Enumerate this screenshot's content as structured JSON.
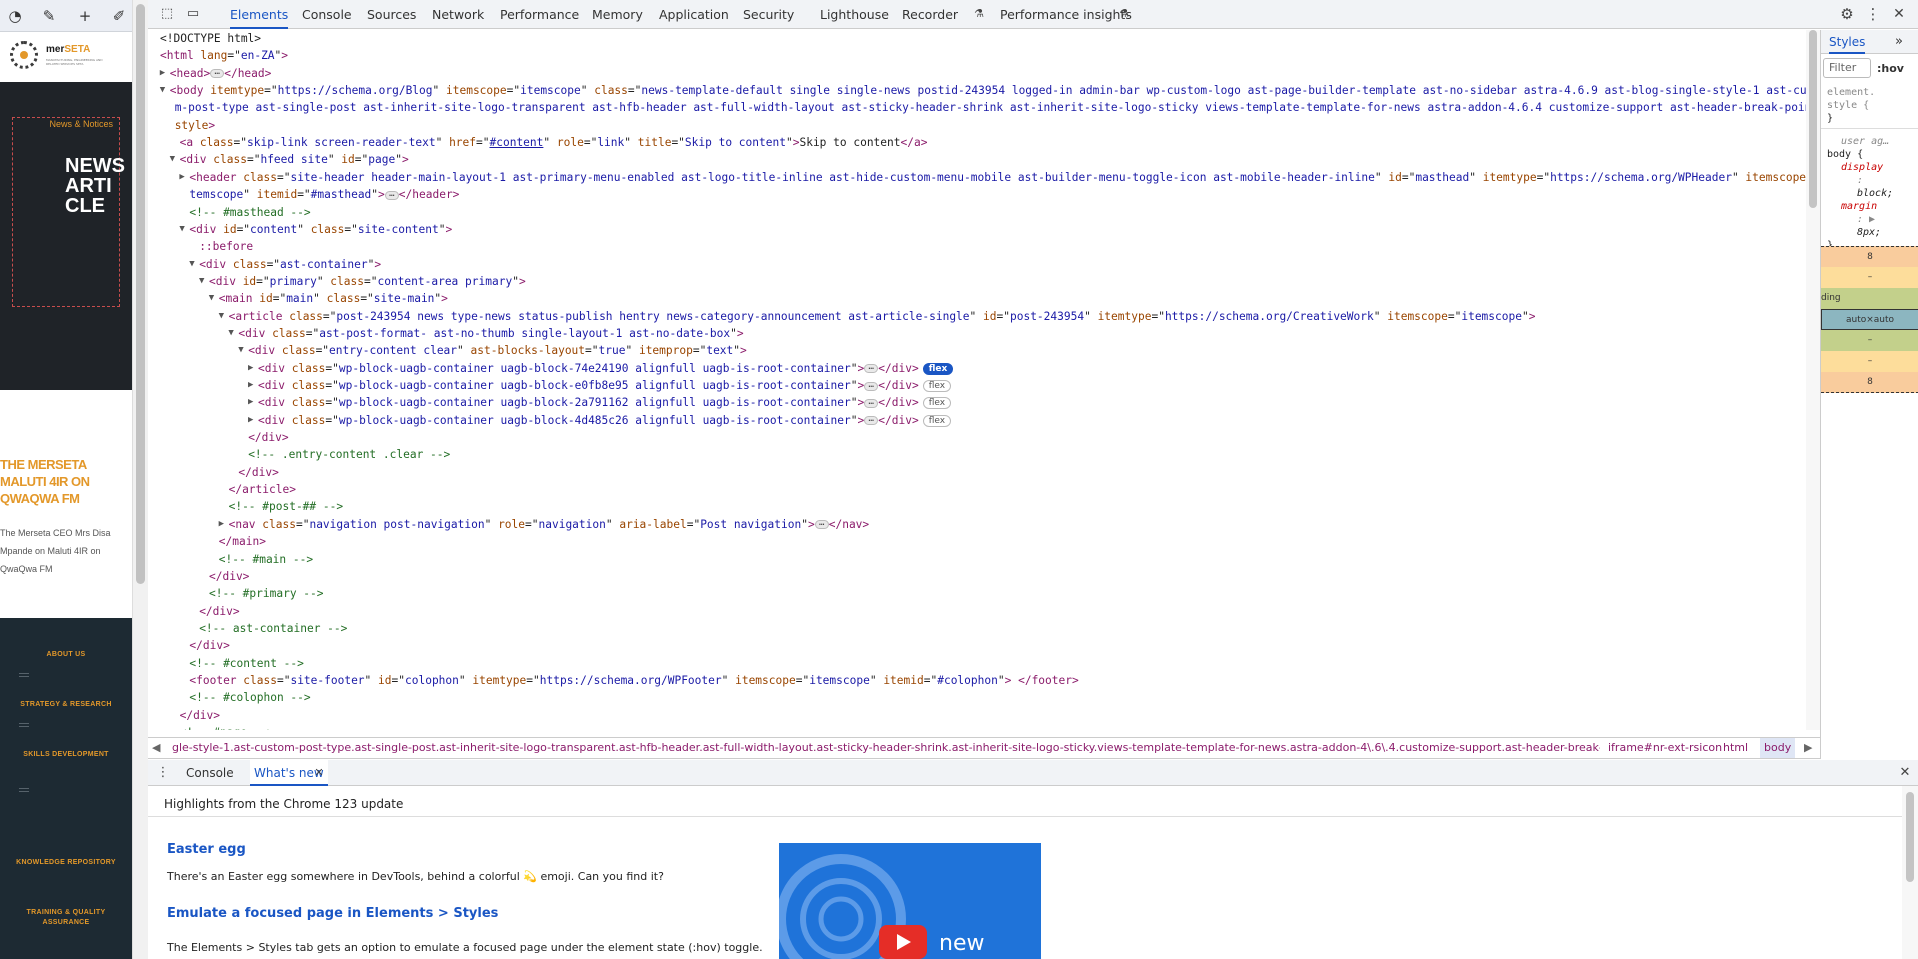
{
  "site": {
    "logo_brand": "mer",
    "logo_brand_accent": "SETA",
    "logo_tagline": "MANUFACTURING, ENGINEERING AND RELATED SERVICES SETA",
    "hero_tag": "News & Notices",
    "hero_title": "NEWS ARTICLE",
    "article_title": "THE MERSETA MALUTI 4IR ON QWAQWA FM",
    "article_desc": "The Merseta CEO Mrs Disa Mpande on Maluti 4IR on QwaQwa FM",
    "menu": [
      "ABOUT US",
      "STRATEGY & RESEARCH",
      "SKILLS DEVELOPMENT",
      "KNOWLEDGE REPOSITORY",
      "TRAINING & QUALITY ASSURANCE"
    ]
  },
  "devtools": {
    "tabs": [
      "Elements",
      "Console",
      "Sources",
      "Network",
      "Performance",
      "Memory",
      "Application",
      "Security",
      "Lighthouse",
      "Recorder",
      "Performance insights"
    ],
    "active_tab": "Elements",
    "breadcrumbs": [
      "gle-style-1.ast-custom-post-type.ast-single-post.ast-inherit-site-logo-transparent.ast-hfb-header.ast-full-width-layout.ast-sticky-header-shrink.ast-inherit-site-logo-sticky.views-template-template-for-news.astra-addon-4\\.6\\.4.customize-support.ast-header-break-point",
      "iframe#nr-ext-rsicon",
      "html",
      "body"
    ],
    "styles": {
      "tab": "Styles",
      "filter_placeholder": "Filter",
      "hov": ":hov",
      "rule1_sel": "element.",
      "rule1_sel2": "style {",
      "rule1_end": "}",
      "ua_label": "user ag…",
      "rule2_sel": "body {",
      "prop1": "display",
      "prop1_val": "block;",
      "prop2": "margin",
      "prop2_val": "8px;",
      "rule2_end": "}",
      "box_margin": "8",
      "box_dash1": "–",
      "box_padding": "ding",
      "box_dash2": "–",
      "box_content": "auto×auto",
      "box_dash3": "–",
      "box_dash4": "–",
      "box_margin_bottom": "8"
    },
    "drawer": {
      "tabs": [
        "Console",
        "What's new"
      ],
      "heading": "Highlights from the Chrome 123 update",
      "item1_title": "Easter egg",
      "item1_text": "There's an Easter egg somewhere in DevTools, behind a colorful 💫 emoji. Can you find it?",
      "item2_title": "Emulate a focused page in Elements > Styles",
      "item2_text": "The Elements > Styles tab gets an option to emulate a focused page under the element state (:hov) toggle.",
      "video_word": "new"
    },
    "colors": {
      "accent": "#1a56c4",
      "brand_orange": "#e3982a",
      "tag": "#8b1c6b",
      "attr_name": "#994500",
      "attr_value": "#1a1aa6",
      "comment": "#236e25"
    }
  },
  "dom": [
    {
      "i": 0,
      "p": [
        [
          "pl",
          "<!DOCTYPE html>"
        ]
      ]
    },
    {
      "i": 0,
      "p": [
        [
          "tag",
          "<html"
        ],
        [
          "an",
          " lang"
        ],
        [
          "pl",
          "=\""
        ],
        [
          "av",
          "en-ZA"
        ],
        [
          "pl",
          "\""
        ],
        [
          "tag",
          ">"
        ]
      ]
    },
    {
      "i": 1,
      "a": "▶",
      "p": [
        [
          "tag",
          "<head>"
        ],
        [
          "ell"
        ],
        [
          "tag",
          "</head>"
        ]
      ]
    },
    {
      "i": 1,
      "a": "▼",
      "p": [
        [
          "tag",
          "<body"
        ],
        [
          "an",
          " itemtype"
        ],
        [
          "pl",
          "=\""
        ],
        [
          "av",
          "https://schema.org/Blog"
        ],
        [
          "pl",
          "\""
        ],
        [
          "an",
          " itemscope"
        ],
        [
          "pl",
          "=\""
        ],
        [
          "av",
          "itemscope"
        ],
        [
          "pl",
          "\""
        ],
        [
          "an",
          " class"
        ],
        [
          "pl",
          "=\""
        ],
        [
          "av",
          "news-template-default single single-news postid-243954 logged-in admin-bar wp-custom-logo ast-page-builder-template ast-no-sidebar astra-4.6.9 ast-blog-single-style-1 ast-custo"
        ]
      ]
    },
    {
      "i": 1.5,
      "p": [
        [
          "av",
          "m-post-type ast-single-post ast-inherit-site-logo-transparent ast-hfb-header ast-full-width-layout ast-sticky-header-shrink ast-inherit-site-logo-sticky views-template-template-for-news astra-addon-4.6.4 customize-support ast-header-break-point"
        ],
        [
          "pl",
          "\""
        ]
      ]
    },
    {
      "i": 1.5,
      "p": [
        [
          "an",
          "style"
        ],
        [
          "tag",
          ">"
        ]
      ]
    },
    {
      "i": 2,
      "p": [
        [
          "tag",
          "<a"
        ],
        [
          "an",
          " class"
        ],
        [
          "pl",
          "=\""
        ],
        [
          "av",
          "skip-link screen-reader-text"
        ],
        [
          "pl",
          "\""
        ],
        [
          "an",
          " href"
        ],
        [
          "pl",
          "=\""
        ],
        [
          "avu",
          "#content"
        ],
        [
          "pl",
          "\""
        ],
        [
          "an",
          " role"
        ],
        [
          "pl",
          "=\""
        ],
        [
          "av",
          "link"
        ],
        [
          "pl",
          "\""
        ],
        [
          "an",
          " title"
        ],
        [
          "pl",
          "=\""
        ],
        [
          "av",
          "Skip to content"
        ],
        [
          "pl",
          "\""
        ],
        [
          "tag",
          ">"
        ],
        [
          "pl",
          "Skip to content"
        ],
        [
          "tag",
          "</a>"
        ]
      ]
    },
    {
      "i": 2,
      "a": "▼",
      "p": [
        [
          "tag",
          "<div"
        ],
        [
          "an",
          " class"
        ],
        [
          "pl",
          "=\""
        ],
        [
          "av",
          "hfeed site"
        ],
        [
          "pl",
          "\""
        ],
        [
          "an",
          " id"
        ],
        [
          "pl",
          "=\""
        ],
        [
          "av",
          "page"
        ],
        [
          "pl",
          "\""
        ],
        [
          "tag",
          ">"
        ]
      ]
    },
    {
      "i": 3,
      "a": "▶",
      "p": [
        [
          "tag",
          "<header"
        ],
        [
          "an",
          " class"
        ],
        [
          "pl",
          "=\""
        ],
        [
          "av",
          "site-header header-main-layout-1 ast-primary-menu-enabled ast-logo-title-inline ast-hide-custom-menu-mobile ast-builder-menu-toggle-icon ast-mobile-header-inline"
        ],
        [
          "pl",
          "\""
        ],
        [
          "an",
          " id"
        ],
        [
          "pl",
          "=\""
        ],
        [
          "av",
          "masthead"
        ],
        [
          "pl",
          "\""
        ],
        [
          "an",
          " itemtype"
        ],
        [
          "pl",
          "=\""
        ],
        [
          "av",
          "https://schema.org/WPHeader"
        ],
        [
          "pl",
          "\""
        ],
        [
          "an",
          " itemscope"
        ],
        [
          "pl",
          "=\"i"
        ]
      ]
    },
    {
      "i": 3,
      "p": [
        [
          "av",
          "temscope"
        ],
        [
          "pl",
          "\""
        ],
        [
          "an",
          " itemid"
        ],
        [
          "pl",
          "=\""
        ],
        [
          "av",
          "#masthead"
        ],
        [
          "pl",
          "\""
        ],
        [
          "tag",
          ">"
        ],
        [
          "ell"
        ],
        [
          "tag",
          "</header>"
        ]
      ]
    },
    {
      "i": 3,
      "p": [
        [
          "cm",
          "<!-- #masthead -->"
        ]
      ]
    },
    {
      "i": 3,
      "a": "▼",
      "p": [
        [
          "tag",
          "<div"
        ],
        [
          "an",
          " id"
        ],
        [
          "pl",
          "=\""
        ],
        [
          "av",
          "content"
        ],
        [
          "pl",
          "\""
        ],
        [
          "an",
          " class"
        ],
        [
          "pl",
          "=\""
        ],
        [
          "av",
          "site-content"
        ],
        [
          "pl",
          "\""
        ],
        [
          "tag",
          ">"
        ]
      ]
    },
    {
      "i": 4,
      "p": [
        [
          "tag",
          "::before"
        ]
      ]
    },
    {
      "i": 4,
      "a": "▼",
      "p": [
        [
          "tag",
          "<div"
        ],
        [
          "an",
          " class"
        ],
        [
          "pl",
          "=\""
        ],
        [
          "av",
          "ast-container"
        ],
        [
          "pl",
          "\""
        ],
        [
          "tag",
          ">"
        ]
      ]
    },
    {
      "i": 5,
      "a": "▼",
      "p": [
        [
          "tag",
          "<div"
        ],
        [
          "an",
          " id"
        ],
        [
          "pl",
          "=\""
        ],
        [
          "av",
          "primary"
        ],
        [
          "pl",
          "\""
        ],
        [
          "an",
          " class"
        ],
        [
          "pl",
          "=\""
        ],
        [
          "av",
          "content-area primary"
        ],
        [
          "pl",
          "\""
        ],
        [
          "tag",
          ">"
        ]
      ]
    },
    {
      "i": 6,
      "a": "▼",
      "p": [
        [
          "tag",
          "<main"
        ],
        [
          "an",
          " id"
        ],
        [
          "pl",
          "=\""
        ],
        [
          "av",
          "main"
        ],
        [
          "pl",
          "\""
        ],
        [
          "an",
          " class"
        ],
        [
          "pl",
          "=\""
        ],
        [
          "av",
          "site-main"
        ],
        [
          "pl",
          "\""
        ],
        [
          "tag",
          ">"
        ]
      ]
    },
    {
      "i": 7,
      "a": "▼",
      "p": [
        [
          "tag",
          "<article"
        ],
        [
          "an",
          " class"
        ],
        [
          "pl",
          "=\""
        ],
        [
          "av",
          "post-243954 news type-news status-publish hentry news-category-announcement ast-article-single"
        ],
        [
          "pl",
          "\""
        ],
        [
          "an",
          " id"
        ],
        [
          "pl",
          "=\""
        ],
        [
          "av",
          "post-243954"
        ],
        [
          "pl",
          "\""
        ],
        [
          "an",
          " itemtype"
        ],
        [
          "pl",
          "=\""
        ],
        [
          "av",
          "https://schema.org/CreativeWork"
        ],
        [
          "pl",
          "\""
        ],
        [
          "an",
          " itemscope"
        ],
        [
          "pl",
          "=\""
        ],
        [
          "av",
          "itemscope"
        ],
        [
          "pl",
          "\""
        ],
        [
          "tag",
          ">"
        ]
      ]
    },
    {
      "i": 8,
      "a": "▼",
      "p": [
        [
          "tag",
          "<div"
        ],
        [
          "an",
          " class"
        ],
        [
          "pl",
          "=\""
        ],
        [
          "av",
          "ast-post-format- ast-no-thumb single-layout-1 ast-no-date-box"
        ],
        [
          "pl",
          "\""
        ],
        [
          "tag",
          ">"
        ]
      ]
    },
    {
      "i": 9,
      "a": "▼",
      "p": [
        [
          "tag",
          "<div"
        ],
        [
          "an",
          " class"
        ],
        [
          "pl",
          "=\""
        ],
        [
          "av",
          "entry-content clear"
        ],
        [
          "pl",
          "\""
        ],
        [
          "an",
          " ast-blocks-layout"
        ],
        [
          "pl",
          "=\""
        ],
        [
          "av",
          "true"
        ],
        [
          "pl",
          "\""
        ],
        [
          "an",
          " itemprop"
        ],
        [
          "pl",
          "=\""
        ],
        [
          "av",
          "text"
        ],
        [
          "pl",
          "\""
        ],
        [
          "tag",
          ">"
        ]
      ]
    },
    {
      "i": 10,
      "a": "▶",
      "p": [
        [
          "tag",
          "<div"
        ],
        [
          "an",
          " class"
        ],
        [
          "pl",
          "=\""
        ],
        [
          "av",
          "wp-block-uagb-container uagb-block-74e24190 alignfull uagb-is-root-container"
        ],
        [
          "pl",
          "\""
        ],
        [
          "tag",
          ">"
        ],
        [
          "ell"
        ],
        [
          "tag",
          "</div>"
        ],
        [
          "flexon",
          "flex"
        ]
      ]
    },
    {
      "i": 10,
      "a": "▶",
      "p": [
        [
          "tag",
          "<div"
        ],
        [
          "an",
          " class"
        ],
        [
          "pl",
          "=\""
        ],
        [
          "av",
          "wp-block-uagb-container uagb-block-e0fb8e95 alignfull uagb-is-root-container"
        ],
        [
          "pl",
          "\""
        ],
        [
          "tag",
          ">"
        ],
        [
          "ell"
        ],
        [
          "tag",
          "</div>"
        ],
        [
          "flex",
          "flex"
        ]
      ]
    },
    {
      "i": 10,
      "a": "▶",
      "p": [
        [
          "tag",
          "<div"
        ],
        [
          "an",
          " class"
        ],
        [
          "pl",
          "=\""
        ],
        [
          "av",
          "wp-block-uagb-container uagb-block-2a791162 alignfull uagb-is-root-container"
        ],
        [
          "pl",
          "\""
        ],
        [
          "tag",
          ">"
        ],
        [
          "ell"
        ],
        [
          "tag",
          "</div>"
        ],
        [
          "flex",
          "flex"
        ]
      ]
    },
    {
      "i": 10,
      "a": "▶",
      "p": [
        [
          "tag",
          "<div"
        ],
        [
          "an",
          " class"
        ],
        [
          "pl",
          "=\""
        ],
        [
          "av",
          "wp-block-uagb-container uagb-block-4d485c26 alignfull uagb-is-root-container"
        ],
        [
          "pl",
          "\""
        ],
        [
          "tag",
          ">"
        ],
        [
          "ell"
        ],
        [
          "tag",
          "</div>"
        ],
        [
          "flex",
          "flex"
        ]
      ]
    },
    {
      "i": 9,
      "p": [
        [
          "tag",
          "</div>"
        ]
      ]
    },
    {
      "i": 9,
      "p": [
        [
          "cm",
          "<!-- .entry-content .clear -->"
        ]
      ]
    },
    {
      "i": 8,
      "p": [
        [
          "tag",
          "</div>"
        ]
      ]
    },
    {
      "i": 7,
      "p": [
        [
          "tag",
          "</article>"
        ]
      ]
    },
    {
      "i": 7,
      "p": [
        [
          "cm",
          "<!-- #post-## -->"
        ]
      ]
    },
    {
      "i": 7,
      "a": "▶",
      "p": [
        [
          "tag",
          "<nav"
        ],
        [
          "an",
          " class"
        ],
        [
          "pl",
          "=\""
        ],
        [
          "av",
          "navigation post-navigation"
        ],
        [
          "pl",
          "\""
        ],
        [
          "an",
          " role"
        ],
        [
          "pl",
          "=\""
        ],
        [
          "av",
          "navigation"
        ],
        [
          "pl",
          "\""
        ],
        [
          "an",
          " aria-label"
        ],
        [
          "pl",
          "=\""
        ],
        [
          "av",
          "Post navigation"
        ],
        [
          "pl",
          "\""
        ],
        [
          "tag",
          ">"
        ],
        [
          "ell"
        ],
        [
          "tag",
          "</nav>"
        ]
      ]
    },
    {
      "i": 6,
      "p": [
        [
          "tag",
          "</main>"
        ]
      ]
    },
    {
      "i": 6,
      "p": [
        [
          "cm",
          "<!-- #main -->"
        ]
      ]
    },
    {
      "i": 5,
      "p": [
        [
          "tag",
          "</div>"
        ]
      ]
    },
    {
      "i": 5,
      "p": [
        [
          "cm",
          "<!-- #primary -->"
        ]
      ]
    },
    {
      "i": 4,
      "p": [
        [
          "tag",
          "</div>"
        ]
      ]
    },
    {
      "i": 4,
      "p": [
        [
          "cm",
          "<!-- ast-container -->"
        ]
      ]
    },
    {
      "i": 3,
      "p": [
        [
          "tag",
          "</div>"
        ]
      ]
    },
    {
      "i": 3,
      "p": [
        [
          "cm",
          "<!-- #content -->"
        ]
      ]
    },
    {
      "i": 3,
      "p": [
        [
          "tag",
          "<footer"
        ],
        [
          "an",
          " class"
        ],
        [
          "pl",
          "=\""
        ],
        [
          "av",
          "site-footer"
        ],
        [
          "pl",
          "\""
        ],
        [
          "an",
          " id"
        ],
        [
          "pl",
          "=\""
        ],
        [
          "av",
          "colophon"
        ],
        [
          "pl",
          "\""
        ],
        [
          "an",
          " itemtype"
        ],
        [
          "pl",
          "=\""
        ],
        [
          "av",
          "https://schema.org/WPFooter"
        ],
        [
          "pl",
          "\""
        ],
        [
          "an",
          " itemscope"
        ],
        [
          "pl",
          "=\""
        ],
        [
          "av",
          "itemscope"
        ],
        [
          "pl",
          "\""
        ],
        [
          "an",
          " itemid"
        ],
        [
          "pl",
          "=\""
        ],
        [
          "av",
          "#colophon"
        ],
        [
          "pl",
          "\""
        ],
        [
          "tag",
          ">"
        ],
        [
          "pl",
          " "
        ],
        [
          "tag",
          "</footer>"
        ]
      ]
    },
    {
      "i": 3,
      "p": [
        [
          "cm",
          "<!-- #colophon -->"
        ]
      ]
    },
    {
      "i": 2,
      "p": [
        [
          "tag",
          "</div>"
        ]
      ]
    },
    {
      "i": 2,
      "p": [
        [
          "cm",
          "<!-- #page -->"
        ]
      ]
    }
  ]
}
